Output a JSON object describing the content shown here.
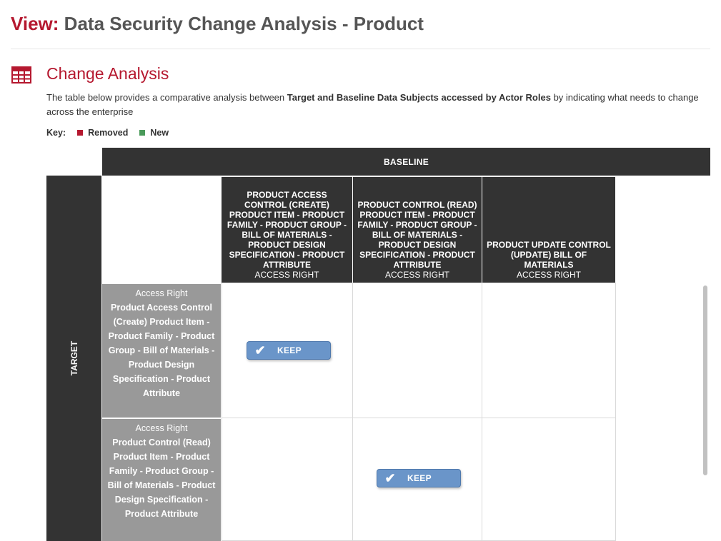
{
  "page": {
    "title_prefix": "View:",
    "title_name": "Data Security Change Analysis - Product"
  },
  "section": {
    "icon": "table-grid-icon",
    "title": "Change Analysis",
    "desc_pre": "The table below provides a comparative analysis between ",
    "desc_bold": "Target and Baseline Data Subjects accessed by Actor Roles",
    "desc_post": " by indicating what needs to change across the enterprise"
  },
  "key": {
    "label": "Key:",
    "removed_label": "Removed",
    "removed_color": "#b5182f",
    "new_label": "New",
    "new_color": "#4a9a5a"
  },
  "matrix": {
    "baseline_label": "BASELINE",
    "target_label": "TARGET",
    "columns": [
      {
        "title": "PRODUCT ACCESS CONTROL (CREATE) PRODUCT ITEM - PRODUCT FAMILY - PRODUCT GROUP - BILL OF MATERIALS - PRODUCT DESIGN SPECIFICATION - PRODUCT ATTRIBUTE",
        "sub": "ACCESS RIGHT"
      },
      {
        "title": "PRODUCT CONTROL (READ) PRODUCT ITEM - PRODUCT FAMILY - PRODUCT GROUP - BILL OF MATERIALS - PRODUCT DESIGN SPECIFICATION - PRODUCT ATTRIBUTE",
        "sub": "ACCESS RIGHT"
      },
      {
        "title": "PRODUCT UPDATE CONTROL (UPDATE) BILL OF MATERIALS",
        "sub": "ACCESS RIGHT"
      }
    ],
    "rows": [
      {
        "sub": "Access Right",
        "title": "Product Access Control (Create) Product Item - Product Family - Product Group - Bill of Materials - Product Design Specification - Product Attribute"
      },
      {
        "sub": "Access Right",
        "title": "Product Control (Read) Product Item - Product Family - Product Group - Bill of Materials - Product Design Specification - Product Attribute"
      }
    ],
    "keep_label": "KEEP",
    "keep_icon": "checkmark-icon",
    "keep_color": "#6a95c9"
  }
}
